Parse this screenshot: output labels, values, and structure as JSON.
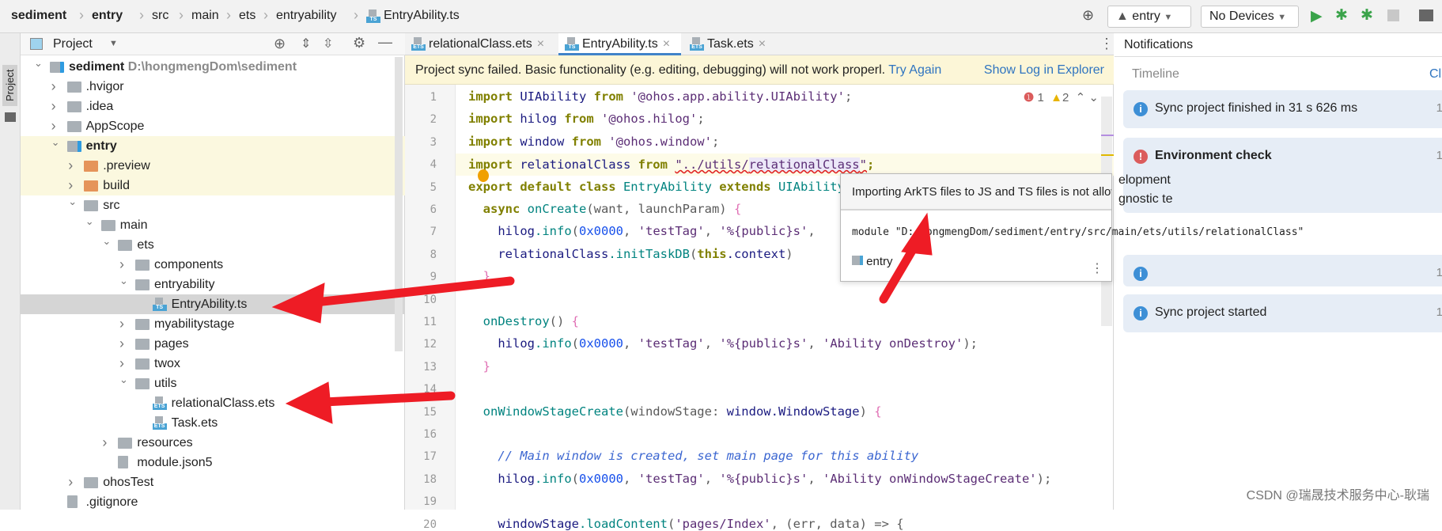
{
  "breadcrumb": [
    "sediment",
    "entry",
    "src",
    "main",
    "ets",
    "entryability",
    "EntryAbility.ts"
  ],
  "toolbar": {
    "config": "entry",
    "device": "No Devices"
  },
  "stripe_label": "Project",
  "project": {
    "title": "Project",
    "tree": [
      {
        "label": "sediment",
        "path": "D:\\hongmengDom\\sediment",
        "level": 0,
        "arrow": "v",
        "icon": "module",
        "bold": true
      },
      {
        "label": ".hvigor",
        "level": 1,
        "arrow": ">",
        "icon": "folder"
      },
      {
        "label": ".idea",
        "level": 1,
        "arrow": ">",
        "icon": "folder"
      },
      {
        "label": "AppScope",
        "level": 1,
        "arrow": ">",
        "icon": "folder"
      },
      {
        "label": "entry",
        "level": 1,
        "arrow": "v",
        "icon": "module",
        "bold": true,
        "yellow": true
      },
      {
        "label": ".preview",
        "level": 2,
        "arrow": ">",
        "icon": "folder-orange",
        "yellow": true
      },
      {
        "label": "build",
        "level": 2,
        "arrow": ">",
        "icon": "folder-orange",
        "yellow": true
      },
      {
        "label": "src",
        "level": 2,
        "arrow": "v",
        "icon": "folder"
      },
      {
        "label": "main",
        "level": 3,
        "arrow": "v",
        "icon": "folder"
      },
      {
        "label": "ets",
        "level": 4,
        "arrow": "v",
        "icon": "folder"
      },
      {
        "label": "components",
        "level": 5,
        "arrow": ">",
        "icon": "folder"
      },
      {
        "label": "entryability",
        "level": 5,
        "arrow": "v",
        "icon": "folder"
      },
      {
        "label": "EntryAbility.ts",
        "level": 6,
        "icon": "TS",
        "selected": true
      },
      {
        "label": "myabilitystage",
        "level": 5,
        "arrow": ">",
        "icon": "folder"
      },
      {
        "label": "pages",
        "level": 5,
        "arrow": ">",
        "icon": "folder"
      },
      {
        "label": "twox",
        "level": 5,
        "arrow": ">",
        "icon": "folder"
      },
      {
        "label": "utils",
        "level": 5,
        "arrow": "v",
        "icon": "folder"
      },
      {
        "label": "relationalClass.ets",
        "level": 6,
        "icon": "ETS"
      },
      {
        "label": "Task.ets",
        "level": 6,
        "icon": "ETS"
      },
      {
        "label": "resources",
        "level": 4,
        "arrow": ">",
        "icon": "folder"
      },
      {
        "label": "module.json5",
        "level": 4,
        "icon": "json"
      },
      {
        "label": "ohosTest",
        "level": 2,
        "arrow": ">",
        "icon": "folder"
      },
      {
        "label": ".gitignore",
        "level": 1,
        "icon": "file"
      }
    ]
  },
  "tabs": [
    {
      "label": "relationalClass.ets",
      "icon": "ETS"
    },
    {
      "label": "EntryAbility.ts",
      "icon": "TS",
      "active": true
    },
    {
      "label": "Task.ets",
      "icon": "ETS"
    }
  ],
  "banner": {
    "message": "Project sync failed. Basic functionality (e.g. editing, debugging) will not work properl.",
    "try_again": "Try Again",
    "show_log": "Show Log in Explorer"
  },
  "issues": {
    "errors": "1",
    "warnings": "2"
  },
  "code": [
    {
      "n": "1",
      "s": [
        [
          "import ",
          "kw"
        ],
        [
          "UIAbility ",
          ""
        ],
        [
          "from ",
          "kw"
        ],
        [
          "'@ohos.app.ability.UIAbility'",
          "st2"
        ],
        [
          ";",
          "pl"
        ]
      ]
    },
    {
      "n": "2",
      "s": [
        [
          "import ",
          "kw"
        ],
        [
          "hilog ",
          ""
        ],
        [
          "from ",
          "kw"
        ],
        [
          "'@ohos.hilog'",
          "st2"
        ],
        [
          ";",
          "pl"
        ]
      ]
    },
    {
      "n": "3",
      "s": [
        [
          "import ",
          "kw"
        ],
        [
          "window ",
          ""
        ],
        [
          "from ",
          "kw"
        ],
        [
          "'@ohos.window'",
          "st2"
        ],
        [
          ";",
          "pl"
        ]
      ]
    },
    {
      "n": "4",
      "hl": true,
      "s": [
        [
          "import ",
          "kw"
        ],
        [
          "relationalClass ",
          ""
        ],
        [
          "from ",
          "kw"
        ],
        [
          "\"../utils/",
          "st2 err"
        ],
        [
          "relationalClass",
          "st2 err hlbox"
        ],
        [
          "\"",
          "st2 err"
        ],
        [
          ";",
          "kw"
        ]
      ]
    },
    {
      "n": "5",
      "s": [
        [
          "export default class ",
          "kw"
        ],
        [
          "EntryAbility ",
          "fn"
        ],
        [
          "extends ",
          "kw"
        ],
        [
          "UIAbility {",
          "fn"
        ]
      ]
    },
    {
      "n": "6",
      "s": [
        [
          "  async ",
          "kw"
        ],
        [
          "onCreate",
          "fn"
        ],
        [
          "(want, launchParam) ",
          "pl"
        ],
        [
          "{",
          "br"
        ]
      ]
    },
    {
      "n": "7",
      "s": [
        [
          "    hilog",
          ""
        ],
        [
          ".info",
          "fn"
        ],
        [
          "(",
          "pl"
        ],
        [
          "0x0000",
          "num"
        ],
        [
          ", ",
          "pl"
        ],
        [
          "'testTag'",
          "st2"
        ],
        [
          ", ",
          "pl"
        ],
        [
          "'%{public}s'",
          "st2"
        ],
        [
          ", ",
          "pl"
        ]
      ]
    },
    {
      "n": "8",
      "s": [
        [
          "    relationalClass",
          ""
        ],
        [
          ".initTaskDB",
          "fn"
        ],
        [
          "(",
          "pl"
        ],
        [
          "this",
          "kw"
        ],
        [
          ".context",
          ""
        ],
        [
          ")",
          "pl"
        ]
      ]
    },
    {
      "n": "9",
      "s": [
        [
          "  }",
          "br"
        ]
      ]
    },
    {
      "n": "10",
      "s": []
    },
    {
      "n": "11",
      "s": [
        [
          "  onDestroy",
          "fn"
        ],
        [
          "() ",
          "pl"
        ],
        [
          "{",
          "br"
        ]
      ]
    },
    {
      "n": "12",
      "s": [
        [
          "    hilog",
          ""
        ],
        [
          ".info",
          "fn"
        ],
        [
          "(",
          "pl"
        ],
        [
          "0x0000",
          "num"
        ],
        [
          ", ",
          "pl"
        ],
        [
          "'testTag'",
          "st2"
        ],
        [
          ", ",
          "pl"
        ],
        [
          "'%{public}s'",
          "st2"
        ],
        [
          ", ",
          "pl"
        ],
        [
          "'Ability onDestroy'",
          "st2"
        ],
        [
          ");",
          "pl"
        ]
      ]
    },
    {
      "n": "13",
      "s": [
        [
          "  }",
          "br"
        ]
      ]
    },
    {
      "n": "14",
      "s": []
    },
    {
      "n": "15",
      "s": [
        [
          "  onWindowStageCreate",
          "fn"
        ],
        [
          "(windowStage: ",
          "pl"
        ],
        [
          "window.WindowStage",
          ""
        ],
        [
          ") ",
          "pl"
        ],
        [
          "{",
          "br"
        ]
      ]
    },
    {
      "n": "16",
      "s": []
    },
    {
      "n": "17",
      "s": [
        [
          "    // Main window is created, set main page for this ability",
          "cm"
        ]
      ]
    },
    {
      "n": "18",
      "s": [
        [
          "    hilog",
          ""
        ],
        [
          ".info",
          "fn"
        ],
        [
          "(",
          "pl"
        ],
        [
          "0x0000",
          "num"
        ],
        [
          ", ",
          "pl"
        ],
        [
          "'testTag'",
          "st2"
        ],
        [
          ", ",
          "pl"
        ],
        [
          "'%{public}s'",
          "st2"
        ],
        [
          ", ",
          "pl"
        ],
        [
          "'Ability onWindowStageCreate'",
          "st2"
        ],
        [
          ");",
          "pl"
        ]
      ]
    },
    {
      "n": "19",
      "s": []
    },
    {
      "n": "20",
      "s": [
        [
          "    windowStage",
          ""
        ],
        [
          ".loadContent",
          "fn"
        ],
        [
          "(",
          "pl"
        ],
        [
          "'pages/Index'",
          "st2"
        ],
        [
          ", (err, data) => {",
          "pl"
        ]
      ]
    }
  ],
  "tooltip": {
    "message": "Importing ArkTS files to JS and TS files is not allowed. <etsLint>",
    "module": "module \"D:/hongmengDom/sediment/entry/src/main/ets/utils/relationalClass\"",
    "entry": "entry"
  },
  "notifications": {
    "title": "Notifications",
    "timeline": "Timeline",
    "clear": "Cl",
    "items": [
      {
        "text": "Sync project finished in 31 s 626 ms",
        "type": "info",
        "time": "1"
      },
      {
        "text": "Environment check",
        "type": "error",
        "time": "1",
        "bold": true,
        "body": [
          "elopment",
          "gnostic te"
        ]
      },
      {
        "text": "",
        "type": "info",
        "time": "1"
      },
      {
        "text": "Sync project started",
        "type": "info",
        "time": "1"
      }
    ]
  },
  "watermark": "CSDN @瑞晟技术服务中心-耿瑞",
  "colors": {
    "accent": "#4083c9",
    "error": "#db5c5c",
    "info": "#3d8fd6",
    "annotation_arrow": "#ee1c25"
  }
}
